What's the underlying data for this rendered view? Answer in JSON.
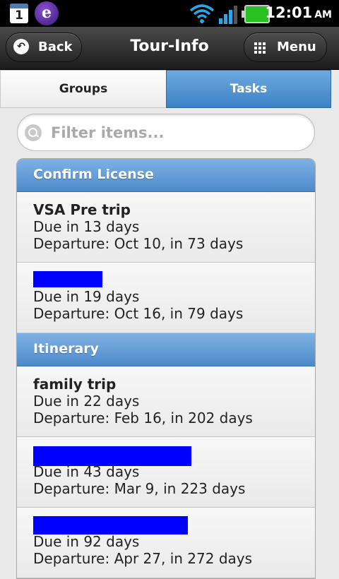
{
  "status": {
    "calendar_day": "1",
    "time": "12:01",
    "ampm": "AM"
  },
  "header": {
    "back_label": "Back",
    "title": "Tour-Info",
    "menu_label": "Menu"
  },
  "tabs": [
    {
      "label": "Groups",
      "active": false
    },
    {
      "label": "Tasks",
      "active": true
    }
  ],
  "search": {
    "placeholder": "Filter items..."
  },
  "sections": [
    {
      "title": "Confirm License",
      "items": [
        {
          "name": "VSA Pre trip",
          "due": "Due in 13 days",
          "departure": "Departure: Oct 10, in 73 days",
          "redacted": false
        },
        {
          "name": "",
          "due": "Due in 19 days",
          "departure": "Departure: Oct 16, in 79 days",
          "redacted": true
        }
      ]
    },
    {
      "title": "Itinerary",
      "items": [
        {
          "name": "family trip",
          "due": "Due in 22 days",
          "departure": "Departure: Feb 16, in 202 days",
          "redacted": false
        },
        {
          "name": "",
          "due": "Due in 43 days",
          "departure": "Departure: Mar 9, in 223 days",
          "redacted": true
        },
        {
          "name": "",
          "due": "Due in 92 days",
          "departure": "Departure: Apr 27, in 272 days",
          "redacted": true
        }
      ]
    }
  ],
  "colors": {
    "accent": "#4d8acb",
    "active_tab": "#3b82c6",
    "redaction": "#0000ff"
  }
}
